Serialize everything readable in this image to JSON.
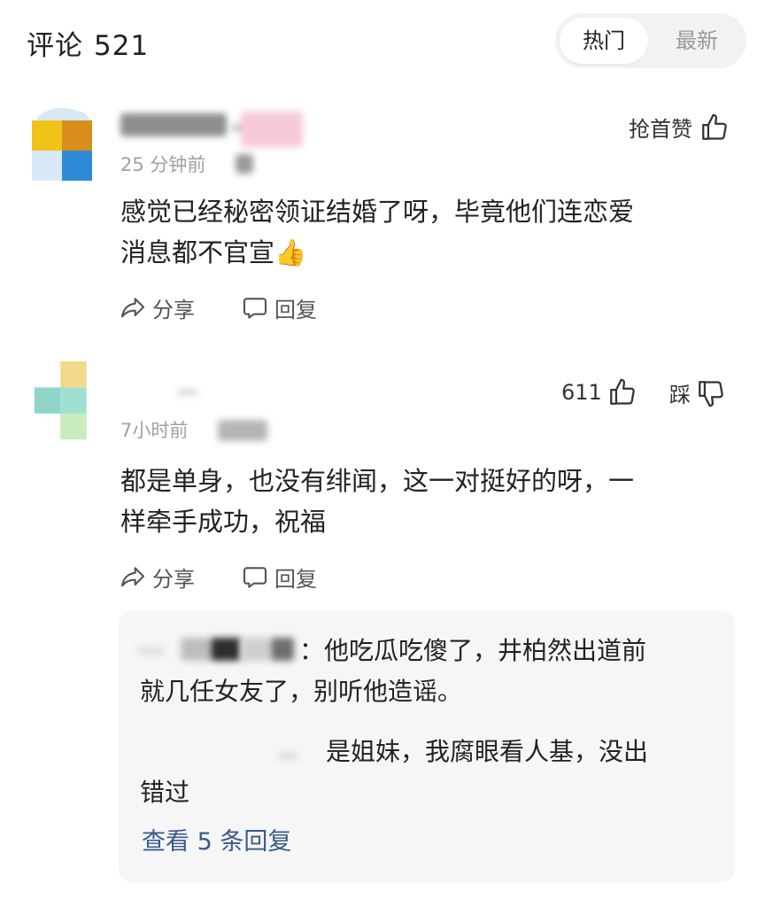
{
  "header": {
    "title": "评论",
    "count": "521",
    "sort_tabs": [
      {
        "label": "热门",
        "active": true
      },
      {
        "label": "最新",
        "active": false
      }
    ]
  },
  "comments": [
    {
      "time": "25 分钟前",
      "first_like_label": "抢首赞",
      "text_line1": "感觉已经秘密领证结婚了呀，毕竟他们连恋爱",
      "text_line2": "消息都不官宣👍",
      "share_label": "分享",
      "reply_label": "回复"
    },
    {
      "time": "7小时前",
      "likes": "611",
      "dislike_label": "踩",
      "text_line1": "都是单身，也没有绯闻，这一对挺好的呀，一",
      "text_line2": "样牵手成功，祝福",
      "share_label": "分享",
      "reply_label": "回复",
      "replies": [
        {
          "line1": "：他吃瓜吃傻了，井柏然出道前",
          "line2": "就几任女友了，别听他造谣。"
        },
        {
          "line1": "是姐妹，我腐眼看人基，没出",
          "line2": "错过"
        }
      ],
      "more_replies_label": "查看 5 条回复"
    }
  ],
  "colors": {
    "accent_link": "#3a5a8c",
    "muted_text": "#a0a0a0",
    "reply_bg": "#f6f6f6"
  }
}
